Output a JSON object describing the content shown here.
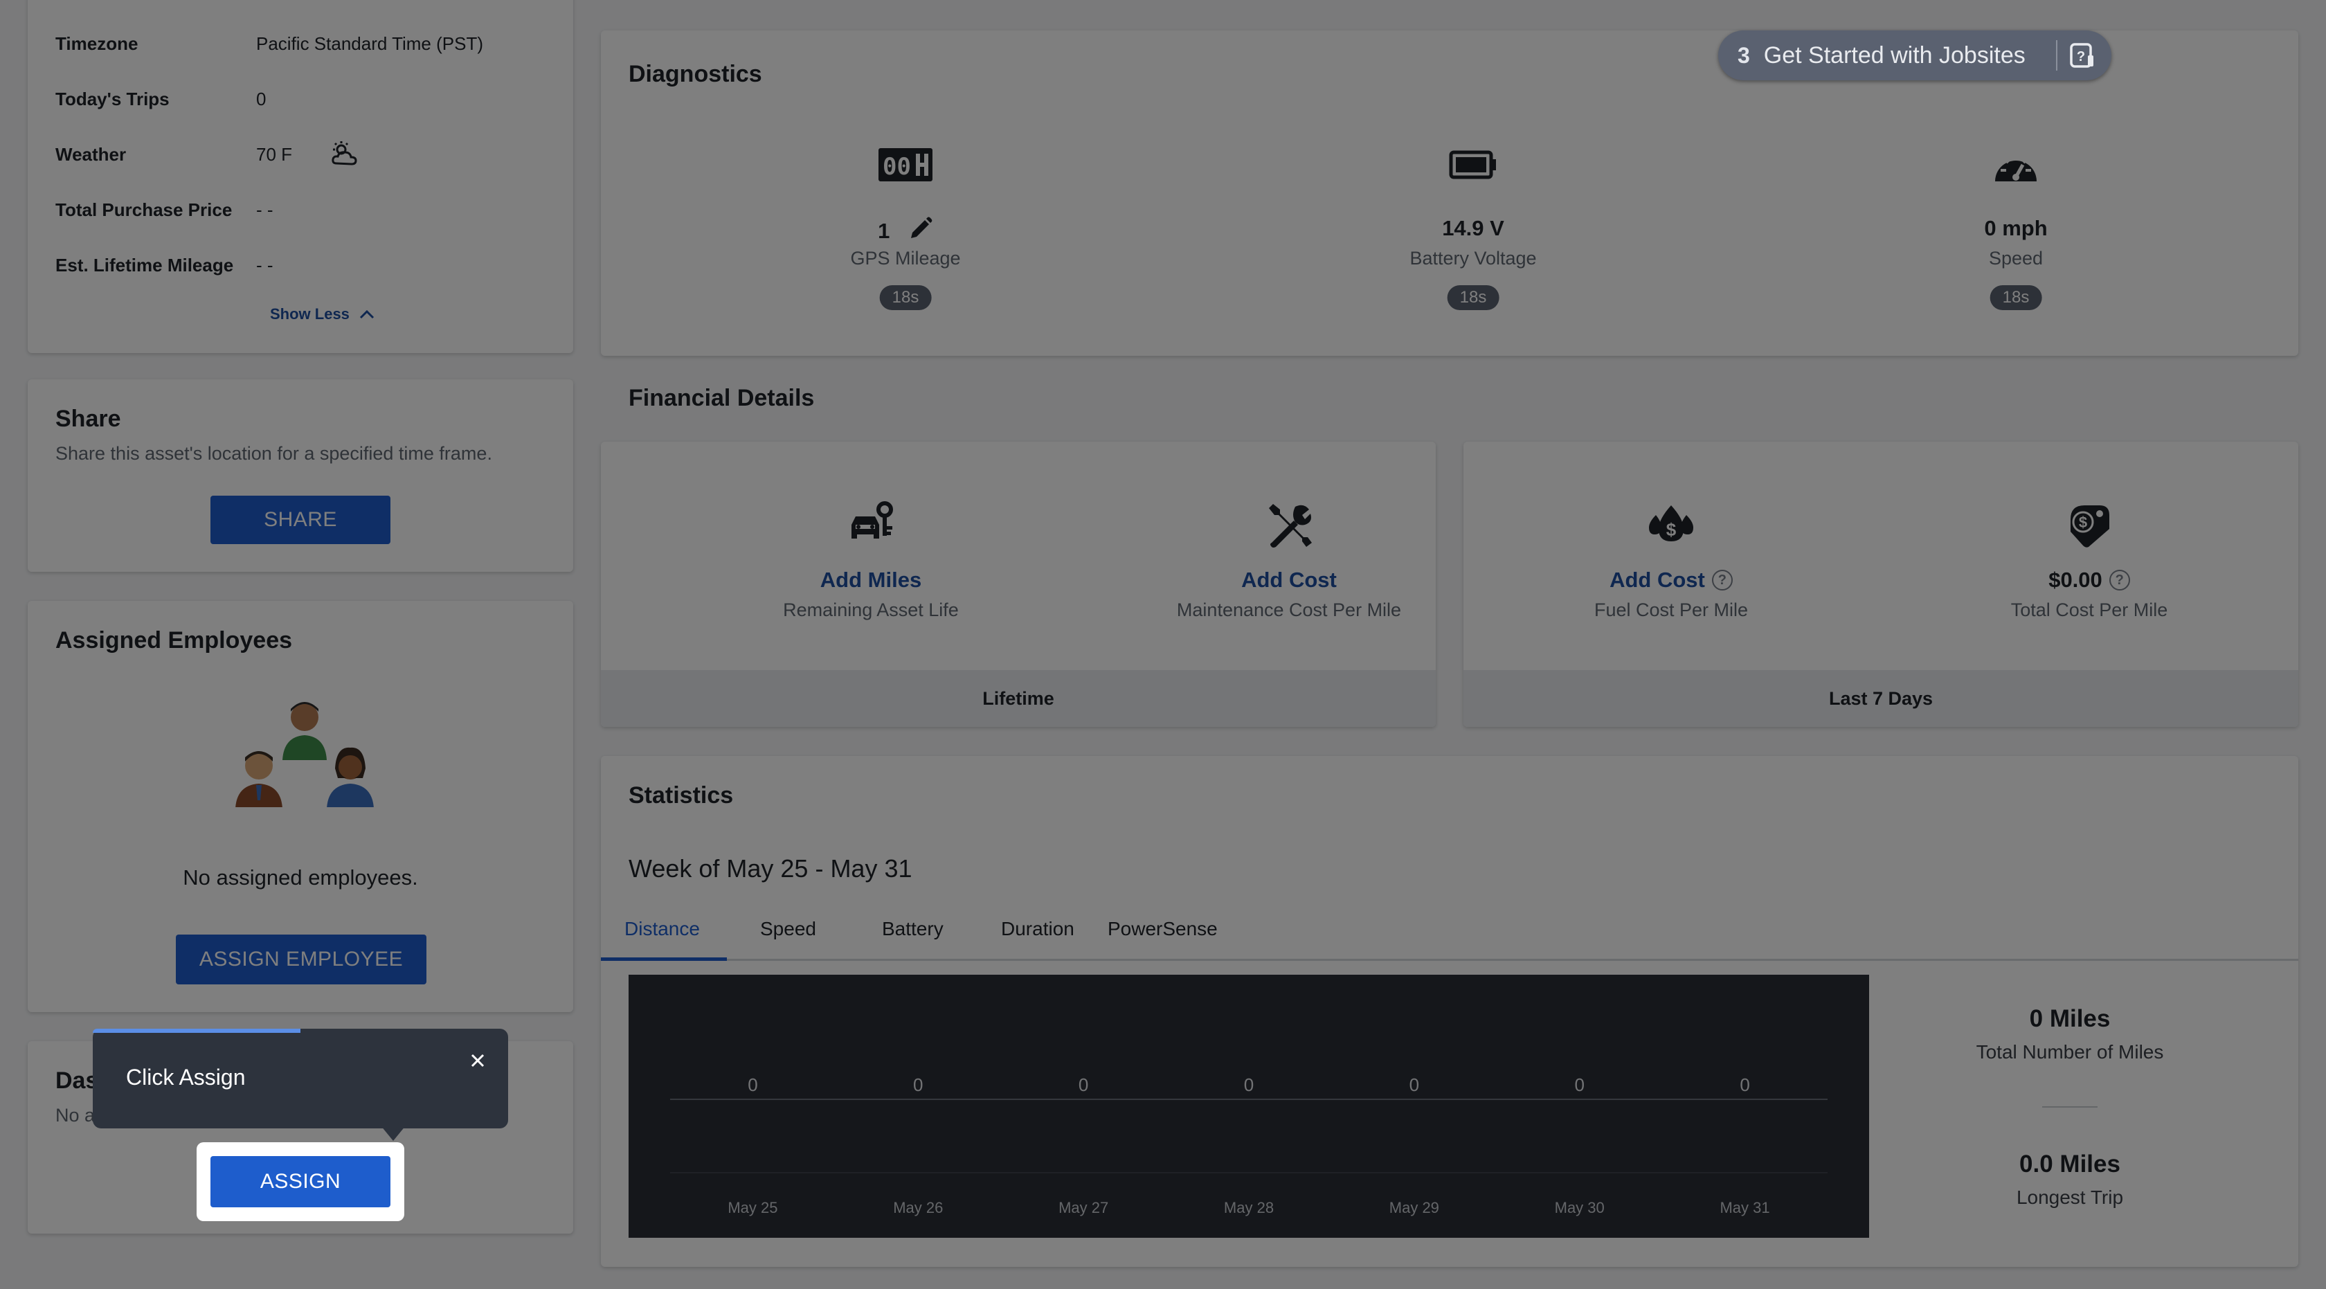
{
  "vehicle_info": {
    "rows": [
      {
        "label": "Timezone",
        "value": "Pacific Standard Time (PST)"
      },
      {
        "label": "Today's Trips",
        "value": "0"
      },
      {
        "label": "Weather",
        "value": "70 F"
      },
      {
        "label": "Total Purchase Price",
        "value": "- -"
      },
      {
        "label": "Est. Lifetime Mileage",
        "value": "- -"
      }
    ],
    "show_less": "Show Less",
    "weather_icon": "partly-cloudy-icon"
  },
  "share": {
    "title": "Share",
    "description": "Share this asset's location for a specified time frame.",
    "button": "SHARE"
  },
  "assigned_employees": {
    "title": "Assigned Employees",
    "empty_text": "No assigned employees.",
    "button": "ASSIGN EMPLOYEE"
  },
  "dashcam": {
    "title_partial": "Das",
    "desc_partial": "No a",
    "button": "ASSIGN"
  },
  "diagnostics": {
    "title": "Diagnostics",
    "metrics": [
      {
        "value": "1",
        "label": "GPS Mileage",
        "badge": "18s",
        "icon": "odometer-icon"
      },
      {
        "value": "14.9 V",
        "label": "Battery Voltage",
        "badge": "18s",
        "icon": "battery-icon"
      },
      {
        "value": "0 mph",
        "label": "Speed",
        "badge": "18s",
        "icon": "speedometer-icon"
      }
    ]
  },
  "financial": {
    "title": "Financial Details",
    "lifetime": {
      "footer": "Lifetime",
      "items": [
        {
          "value": "Add Miles",
          "label": "Remaining Asset Life",
          "icon": "car-key-icon"
        },
        {
          "value": "Add Cost",
          "label": "Maintenance Cost Per Mile",
          "icon": "tools-icon"
        }
      ]
    },
    "last7": {
      "footer": "Last 7 Days",
      "items": [
        {
          "value": "Add Cost",
          "label": "Fuel Cost Per Mile",
          "icon": "fuel-drop-dollar-icon"
        },
        {
          "value": "$0.00",
          "label": "Total Cost Per Mile",
          "icon": "price-tag-dollar-icon"
        }
      ]
    }
  },
  "statistics": {
    "title": "Statistics",
    "week": "Week of May 25 - May 31",
    "tabs": [
      "Distance",
      "Speed",
      "Battery",
      "Duration",
      "PowerSense"
    ],
    "active_tab": "Distance",
    "total_miles": "0 Miles",
    "total_miles_label": "Total Number of Miles",
    "longest_trip": "0.0 Miles",
    "longest_trip_label": "Longest Trip"
  },
  "chart_data": {
    "type": "bar",
    "categories": [
      "May 25",
      "May 26",
      "May 27",
      "May 28",
      "May 29",
      "May 30",
      "May 31"
    ],
    "values": [
      0,
      0,
      0,
      0,
      0,
      0,
      0
    ],
    "data_labels": [
      "0",
      "0",
      "0",
      "0",
      "0",
      "0",
      "0"
    ],
    "title": "",
    "xlabel": "",
    "ylabel": ""
  },
  "tour": {
    "tooltip_text": "Click Assign",
    "jobsites_count": "3",
    "jobsites_label": "Get Started with Jobsites"
  },
  "colors": {
    "primary": "#1e5dcc",
    "link": "#1e4fa0",
    "chart_bg": "#2b2f36",
    "tooltip_bg": "#2d333d"
  }
}
